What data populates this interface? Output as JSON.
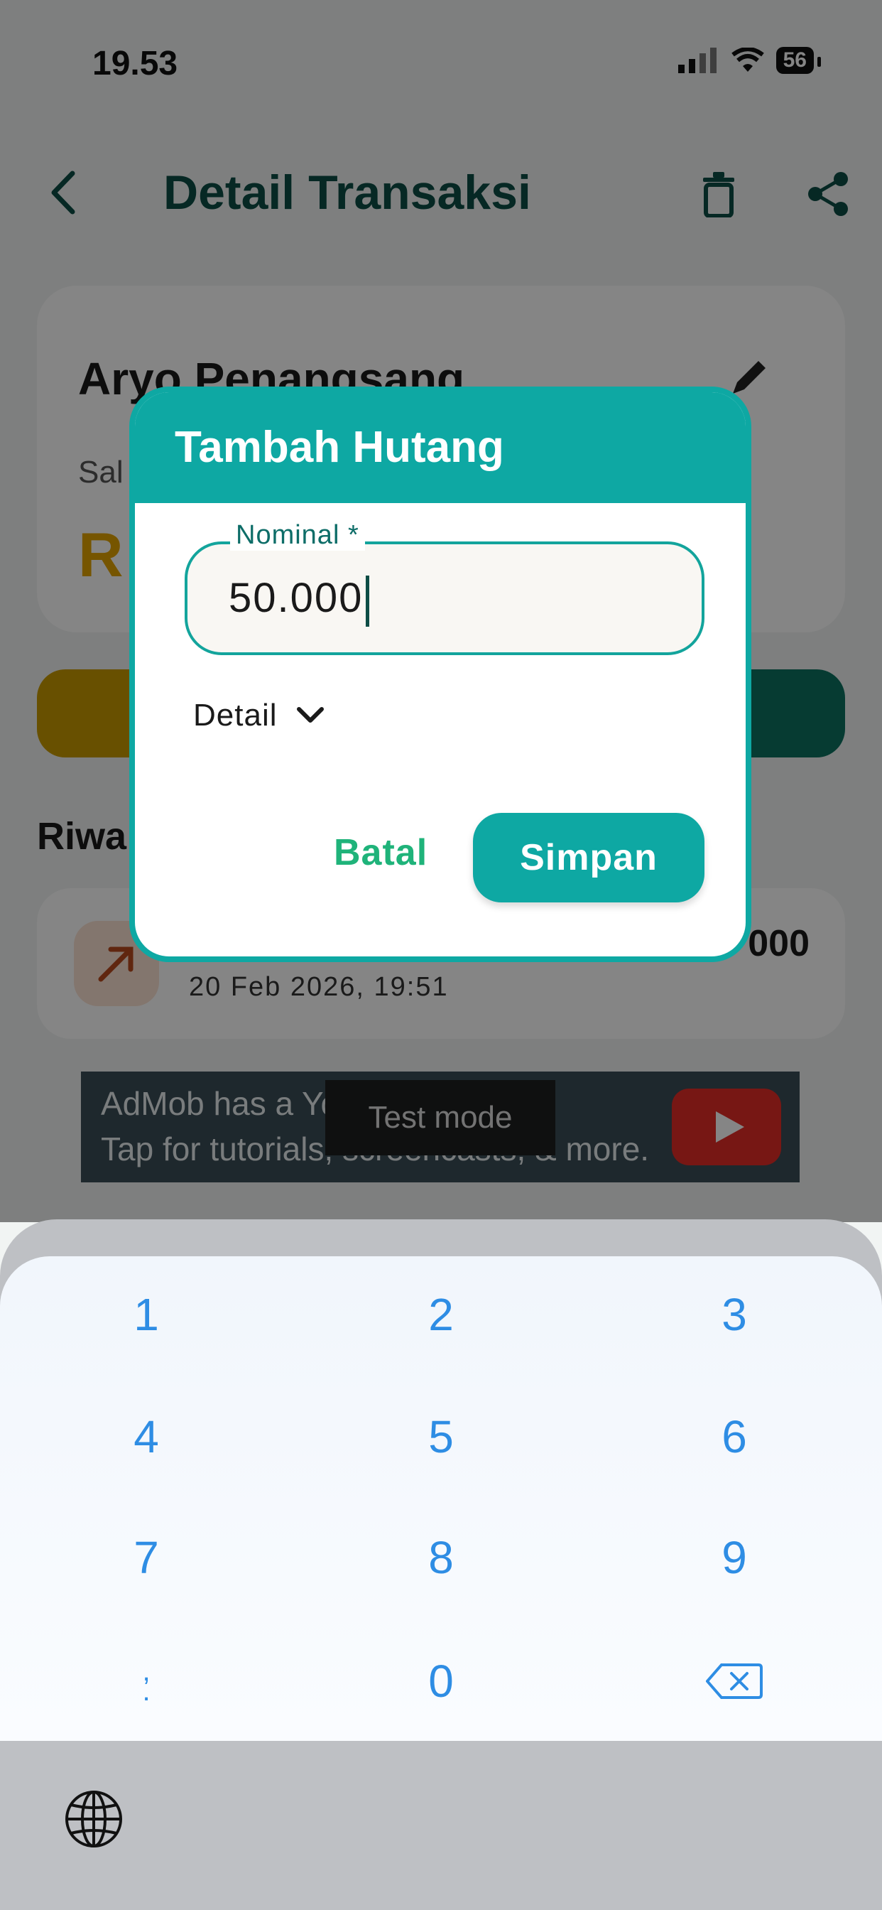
{
  "status_bar": {
    "time": "19.53",
    "battery": "56"
  },
  "header": {
    "title": "Detail Transaksi"
  },
  "person": {
    "name": "Aryo Penangsang",
    "saldo_label": "Sal",
    "saldo_value": "R"
  },
  "history": {
    "title": "Riwa",
    "amount": "000",
    "date": "20 Feb 2026, 19:51"
  },
  "ad": {
    "line1": "AdMob has a Yo",
    "line2": "Tap for tutorials, screencasts, & more.",
    "test_mode": "Test mode"
  },
  "dialog": {
    "title": "Tambah Hutang",
    "nominal_label": "Nominal *",
    "nominal_value": "50.000",
    "detail_label": "Detail",
    "cancel_label": "Batal",
    "save_label": "Simpan"
  },
  "keyboard": {
    "keys": [
      "1",
      "2",
      "3",
      "4",
      "5",
      "6",
      "7",
      "8",
      "9",
      ",\n.",
      "0"
    ]
  },
  "colors": {
    "accent": "#0ea8a3",
    "header_text": "#0d4d45",
    "cancel_text": "#1fb37a",
    "key_text": "#2e8de4"
  }
}
